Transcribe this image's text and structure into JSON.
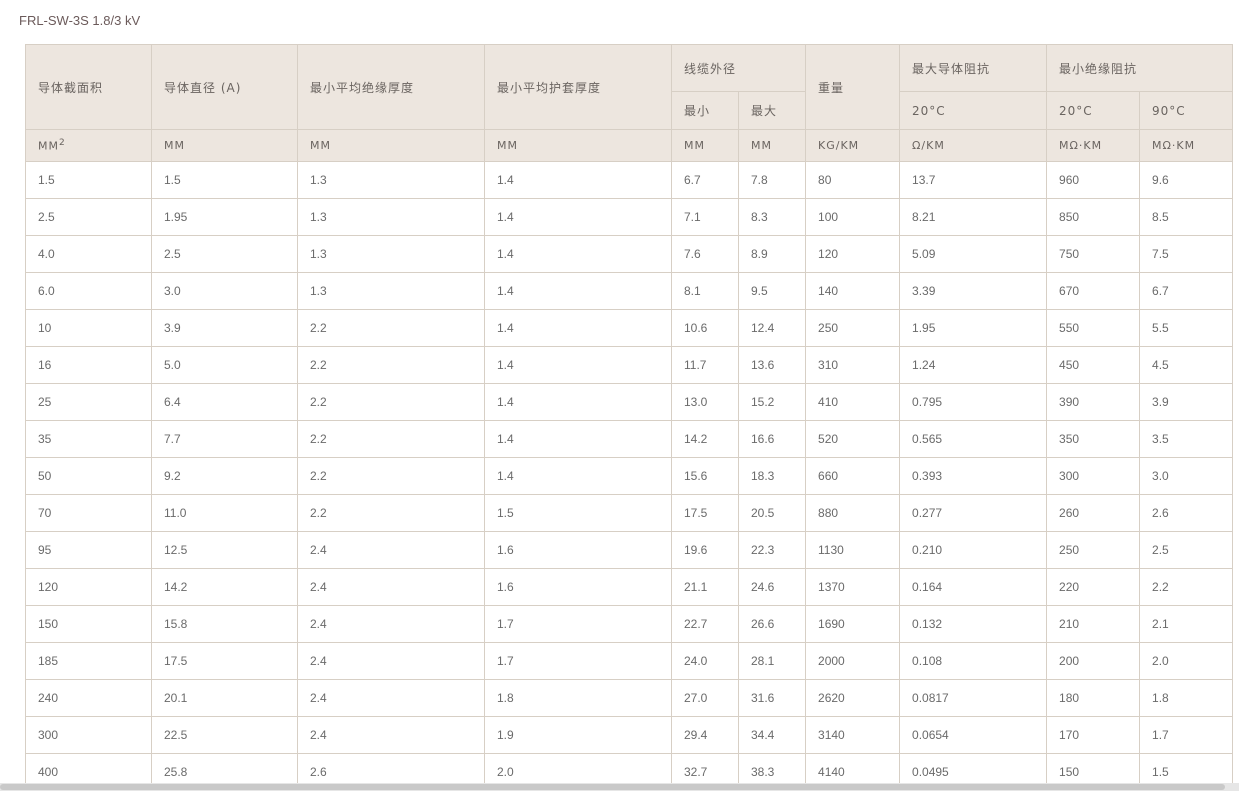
{
  "caption": "FRL-SW-3S 1.8/3 kV",
  "headers": {
    "conductor_area": "导体截面积",
    "conductor_diameter": "导体直径 (A)",
    "min_insulation": "最小平均绝缘厚度",
    "min_sheath": "最小平均护套厚度",
    "cable_od": "线缆外径",
    "od_min": "最小",
    "od_max": "最大",
    "weight": "重量",
    "max_resistance": "最大导体阻抗",
    "max_resistance_temp": "20°C",
    "min_insulation_resistance": "最小绝缘阻抗",
    "ir_temp_20": "20°C",
    "ir_temp_90": "90°C"
  },
  "units": {
    "area": "MM",
    "area_exp": "2",
    "diameter": "MM",
    "insulation": "MM",
    "sheath": "MM",
    "od_min": "MM",
    "od_max": "MM",
    "weight": "KG/KM",
    "resistance": "Ω/KM",
    "ir_20": "MΩ·KM",
    "ir_90": "MΩ·KM"
  },
  "rows": [
    [
      "1.5",
      "1.5",
      "1.3",
      "1.4",
      "6.7",
      "7.8",
      "80",
      "13.7",
      "960",
      "9.6"
    ],
    [
      "2.5",
      "1.95",
      "1.3",
      "1.4",
      "7.1",
      "8.3",
      "100",
      "8.21",
      "850",
      "8.5"
    ],
    [
      "4.0",
      "2.5",
      "1.3",
      "1.4",
      "7.6",
      "8.9",
      "120",
      "5.09",
      "750",
      "7.5"
    ],
    [
      "6.0",
      "3.0",
      "1.3",
      "1.4",
      "8.1",
      "9.5",
      "140",
      "3.39",
      "670",
      "6.7"
    ],
    [
      "10",
      "3.9",
      "2.2",
      "1.4",
      "10.6",
      "12.4",
      "250",
      "1.95",
      "550",
      "5.5"
    ],
    [
      "16",
      "5.0",
      "2.2",
      "1.4",
      "11.7",
      "13.6",
      "310",
      "1.24",
      "450",
      "4.5"
    ],
    [
      "25",
      "6.4",
      "2.2",
      "1.4",
      "13.0",
      "15.2",
      "410",
      "0.795",
      "390",
      "3.9"
    ],
    [
      "35",
      "7.7",
      "2.2",
      "1.4",
      "14.2",
      "16.6",
      "520",
      "0.565",
      "350",
      "3.5"
    ],
    [
      "50",
      "9.2",
      "2.2",
      "1.4",
      "15.6",
      "18.3",
      "660",
      "0.393",
      "300",
      "3.0"
    ],
    [
      "70",
      "11.0",
      "2.2",
      "1.5",
      "17.5",
      "20.5",
      "880",
      "0.277",
      "260",
      "2.6"
    ],
    [
      "95",
      "12.5",
      "2.4",
      "1.6",
      "19.6",
      "22.3",
      "1130",
      "0.210",
      "250",
      "2.5"
    ],
    [
      "120",
      "14.2",
      "2.4",
      "1.6",
      "21.1",
      "24.6",
      "1370",
      "0.164",
      "220",
      "2.2"
    ],
    [
      "150",
      "15.8",
      "2.4",
      "1.7",
      "22.7",
      "26.6",
      "1690",
      "0.132",
      "210",
      "2.1"
    ],
    [
      "185",
      "17.5",
      "2.4",
      "1.7",
      "24.0",
      "28.1",
      "2000",
      "0.108",
      "200",
      "2.0"
    ],
    [
      "240",
      "20.1",
      "2.4",
      "1.8",
      "27.0",
      "31.6",
      "2620",
      "0.0817",
      "180",
      "1.8"
    ],
    [
      "300",
      "22.5",
      "2.4",
      "1.9",
      "29.4",
      "34.4",
      "3140",
      "0.0654",
      "170",
      "1.7"
    ],
    [
      "400",
      "25.8",
      "2.6",
      "2.0",
      "32.7",
      "38.3",
      "4140",
      "0.0495",
      "150",
      "1.5"
    ]
  ]
}
